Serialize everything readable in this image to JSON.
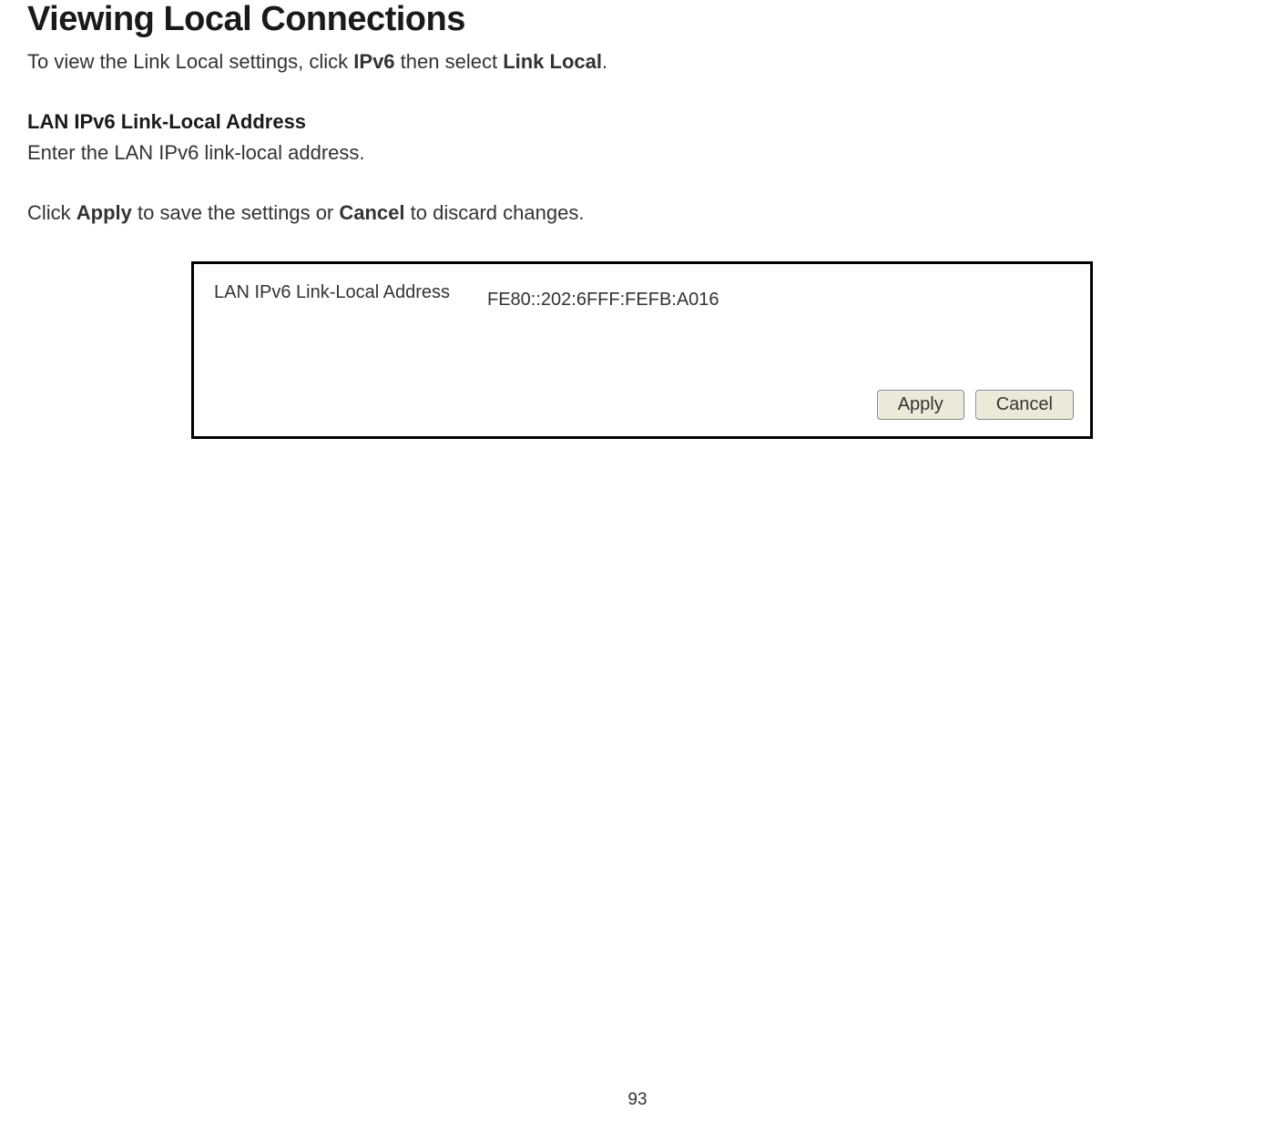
{
  "heading": "Viewing Local Connections",
  "intro": {
    "pre": "To view the Link Local settings, click ",
    "bold1": "IPv6",
    "mid": " then select ",
    "bold2": "Link Local",
    "end": "."
  },
  "subheading": "LAN IPv6 Link-Local Address",
  "body_text": "Enter the LAN IPv6 link-local address.",
  "action": {
    "pre": "Click ",
    "bold1": "Apply",
    "mid": " to save the settings or ",
    "bold2": "Cancel",
    "end": " to discard changes."
  },
  "panel": {
    "label": "LAN IPv6 Link-Local Address",
    "value": "FE80::202:6FFF:FEFB:A016",
    "apply_label": "Apply",
    "cancel_label": "Cancel"
  },
  "page_number": "93"
}
